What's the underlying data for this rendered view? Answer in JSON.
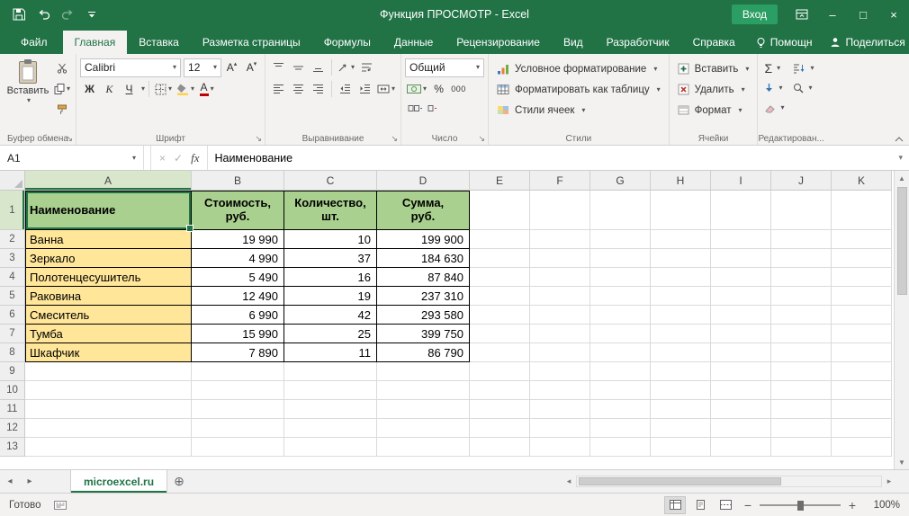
{
  "colors": {
    "accent_green": "#217346",
    "table_header_fill": "#a9d08e",
    "name_column_fill": "#ffe699"
  },
  "titlebar": {
    "title": "Функция ПРОСМОТР  -  Excel",
    "signin_label": "Вход"
  },
  "tabs": [
    "Файл",
    "Главная",
    "Вставка",
    "Разметка страницы",
    "Формулы",
    "Данные",
    "Рецензирование",
    "Вид",
    "Разработчик",
    "Справка"
  ],
  "tabs_right": {
    "assistant_label": "Помощн",
    "share_label": "Поделиться"
  },
  "ribbon": {
    "clipboard": {
      "group_label": "Буфер обмена",
      "paste_label": "Вставить"
    },
    "font": {
      "group_label": "Шрифт",
      "font_name": "Calibri",
      "font_size": "12",
      "bold_label": "Ж",
      "italic_label": "К",
      "underline_label": "Ч",
      "letter_icon": "А"
    },
    "alignment": {
      "group_label": "Выравнивание"
    },
    "number": {
      "group_label": "Число",
      "format": "Общий",
      "percent_label": "%",
      "thousands_label": "000"
    },
    "styles": {
      "group_label": "Стили",
      "conditional_label": "Условное форматирование",
      "table_label": "Форматировать как таблицу",
      "cell_styles_label": "Стили ячеек"
    },
    "cells": {
      "group_label": "Ячейки",
      "insert_label": "Вставить",
      "delete_label": "Удалить",
      "format_label": "Формат"
    },
    "editing": {
      "group_label": "Редактирован...",
      "autosum_label": "Σ"
    }
  },
  "formula_bar": {
    "name_box": "A1",
    "fx_label": "fx",
    "value": "Наименование"
  },
  "sheet": {
    "columns": [
      "A",
      "B",
      "C",
      "D",
      "E",
      "F",
      "G",
      "H",
      "I",
      "J",
      "K"
    ],
    "visible_rows": 13,
    "header_row": [
      "Наименование",
      "Стоимость,\nруб.",
      "Количество,\nшт.",
      "Сумма,\nруб."
    ],
    "rows": [
      [
        "Ванна",
        "19 990",
        "10",
        "199 900"
      ],
      [
        "Зеркало",
        "4 990",
        "37",
        "184 630"
      ],
      [
        "Полотенцесушитель",
        "5 490",
        "16",
        "87 840"
      ],
      [
        "Раковина",
        "12 490",
        "19",
        "237 310"
      ],
      [
        "Смеситель",
        "6 990",
        "42",
        "293 580"
      ],
      [
        "Тумба",
        "15 990",
        "25",
        "399 750"
      ],
      [
        "Шкафчик",
        "7 890",
        "11",
        "86 790"
      ]
    ]
  },
  "sheet_tabs": {
    "active_tab": "microexcel.ru"
  },
  "status_bar": {
    "ready_label": "Готово",
    "zoom_level": "100%"
  }
}
